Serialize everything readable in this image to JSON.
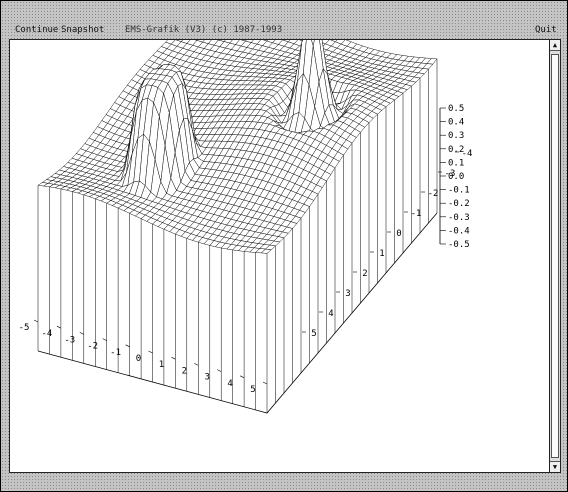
{
  "menubar": {
    "continue_label": "Continue",
    "snapshot_label": "Snapshot",
    "title_label": "EMS-Grafik (V3)  (c) 1987-1993",
    "quit_label": "Quit"
  },
  "scrollbar": {
    "up_glyph": "▲",
    "down_glyph": "▼"
  },
  "chart_data": {
    "type": "surface",
    "x": {
      "range": [
        -5,
        5
      ],
      "ticks": [
        "-5",
        "-4",
        "-3",
        "-2",
        "-1",
        "0",
        "1",
        "2",
        "3",
        "4",
        "5"
      ]
    },
    "y": {
      "range": [
        -5,
        5
      ],
      "ticks": [
        "-4",
        "-3",
        "-2",
        "-1",
        "0",
        "1",
        "2",
        "3",
        "4",
        "5"
      ]
    },
    "z": {
      "range": [
        -0.5,
        0.5
      ],
      "ticks": [
        "0.5",
        "0.4",
        "0.3",
        "0.2",
        "0.1",
        "0.0",
        "-0.1",
        "-0.2",
        "-0.3",
        "-0.4",
        "-0.5"
      ]
    },
    "grid_lines": 41,
    "features": [
      {
        "kind": "flat-top peak",
        "x": -1.5,
        "y": -2.5,
        "height": 0.5,
        "radius": 1.1
      },
      {
        "kind": "sharp peak with depression ring",
        "x": 2.5,
        "y": 1.0,
        "height": 0.5,
        "radius": 0.9
      }
    ]
  }
}
